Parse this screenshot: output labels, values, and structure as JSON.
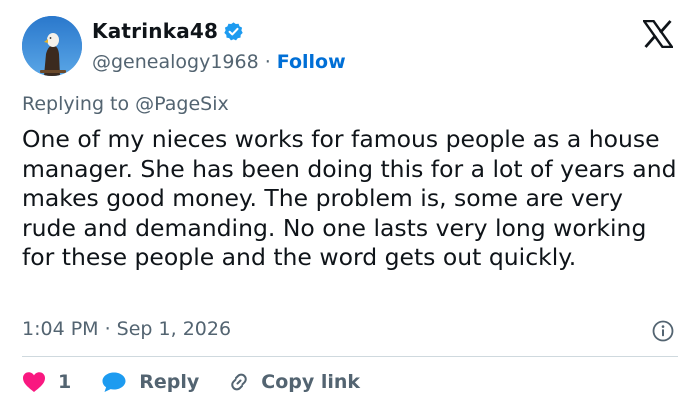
{
  "author": {
    "display_name": "Katrinka48",
    "handle": "@genealogy1968",
    "separator": "·",
    "follow_label": "Follow",
    "verified": true
  },
  "reply_context": {
    "prefix": "Replying to",
    "mention": "@PageSix"
  },
  "tweet": {
    "text": "One of my nieces works for famous people as a house manager. She has been doing this for a lot of years and makes good money. The problem is, some are very rude and demanding. No one lasts very long working for these people and the word gets out quickly.",
    "timestamp": "1:04 PM · Sep 1, 2026"
  },
  "actions": {
    "like_count": "1",
    "reply_label": "Reply",
    "copy_link_label": "Copy link"
  },
  "icons": {
    "avatar": "eagle-avatar",
    "verified": "verified-badge-icon",
    "brand": "x-logo-icon",
    "info": "info-icon",
    "like": "heart-icon",
    "reply": "reply-bubble-icon",
    "copy": "link-icon"
  },
  "colors": {
    "text": "#0f1419",
    "secondary": "#536471",
    "link": "#006fd6",
    "verified": "#1d9bf0",
    "like": "#f91880",
    "reply": "#1d9bf0",
    "divider": "#cfd9de"
  }
}
